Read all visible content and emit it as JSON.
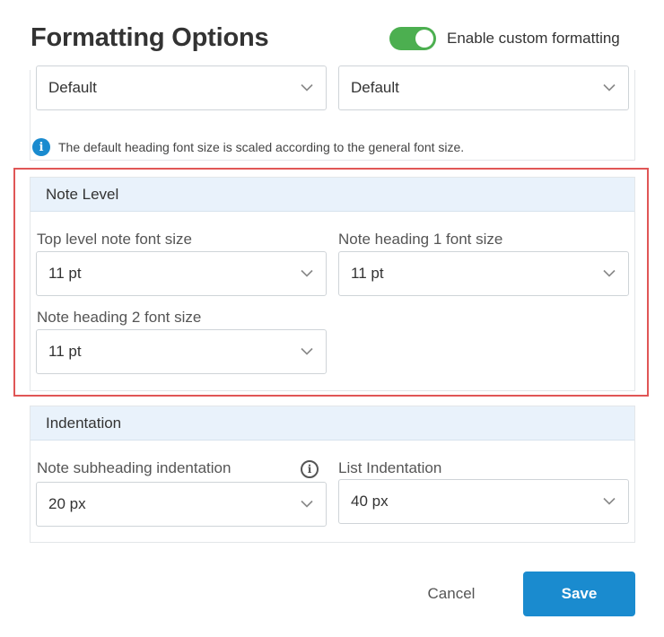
{
  "dialog": {
    "title": "Formatting Options",
    "toggle": {
      "label": "Enable custom formatting",
      "on": true,
      "color": "#4caf50"
    }
  },
  "top_section": {
    "select_left": {
      "value": "Default"
    },
    "select_right": {
      "value": "Default"
    },
    "info_text": "The default heading font size is scaled according to the general font size."
  },
  "note_level": {
    "header": "Note Level",
    "top_level": {
      "label": "Top level note font size",
      "value": "11 pt"
    },
    "heading1": {
      "label": "Note heading 1 font size",
      "value": "11 pt"
    },
    "heading2": {
      "label": "Note heading 2 font size",
      "value": "11 pt"
    }
  },
  "indentation": {
    "header": "Indentation",
    "subheading": {
      "label": "Note subheading indentation",
      "value": "20 px"
    },
    "list": {
      "label": "List Indentation",
      "value": "40 px"
    }
  },
  "footer": {
    "cancel_label": "Cancel",
    "save_label": "Save"
  },
  "colors": {
    "accent": "#1a8bcf",
    "panel_header_bg": "#e9f2fb",
    "highlight": "#e05656"
  }
}
